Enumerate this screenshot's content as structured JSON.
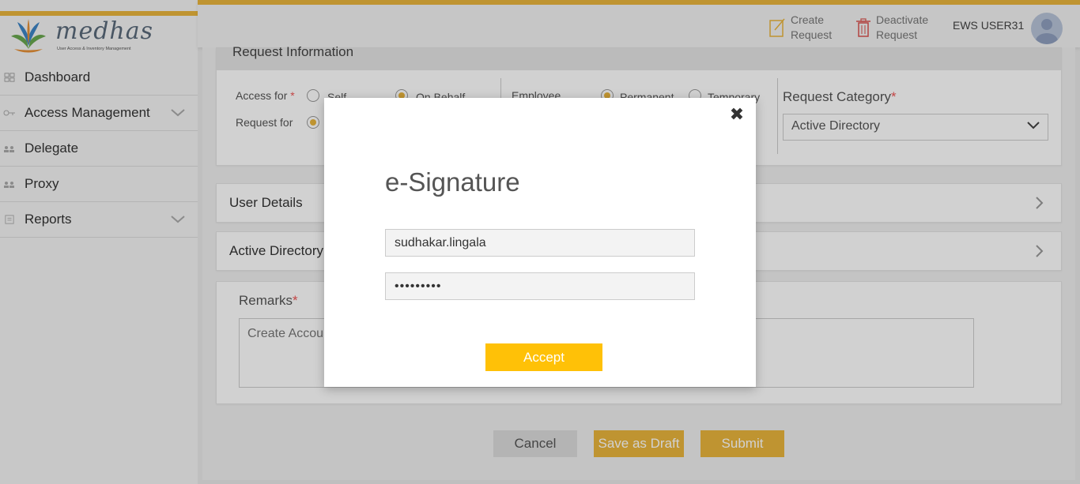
{
  "app": {
    "brand": "medhas",
    "tagline": "User Access & Inventory Management",
    "accent_color": "#e9b53c",
    "accept_color": "#ffc107"
  },
  "sidebar": {
    "items": [
      {
        "label": "Dashboard",
        "icon": "dashboard-icon",
        "expandable": false
      },
      {
        "label": "Access Management",
        "icon": "key-icon",
        "expandable": true
      },
      {
        "label": "Delegate",
        "icon": "people-icon",
        "expandable": false
      },
      {
        "label": "Proxy",
        "icon": "people-icon",
        "expandable": false
      },
      {
        "label": "Reports",
        "icon": "report-icon",
        "expandable": true
      }
    ]
  },
  "header": {
    "create_line1": "Create",
    "create_line2": "Request",
    "deactivate_line1": "Deactivate",
    "deactivate_line2": "Request",
    "user_name": "EWS USER31"
  },
  "request_info": {
    "title": "Request Information",
    "access_for_label": "Access for",
    "access_for_options": [
      "Self",
      "On Behalf"
    ],
    "access_for_selected": "On Behalf",
    "request_for_label": "Request for",
    "employee_label": "Employee",
    "employee_options": [
      "Permanent",
      "Temporary"
    ],
    "employee_selected": "Permanent",
    "category_label": "Request Category",
    "category_value": "Active Directory"
  },
  "sections": {
    "user_details": "User Details",
    "active_directory": "Active Directory"
  },
  "remarks": {
    "label": "Remarks",
    "value": "Create Accou"
  },
  "footer_buttons": {
    "cancel": "Cancel",
    "draft": "Save as Draft",
    "submit": "Submit"
  },
  "modal": {
    "title": "e-Signature",
    "username": "sudhakar.lingala",
    "password": "•••••••••",
    "accept": "Accept"
  }
}
